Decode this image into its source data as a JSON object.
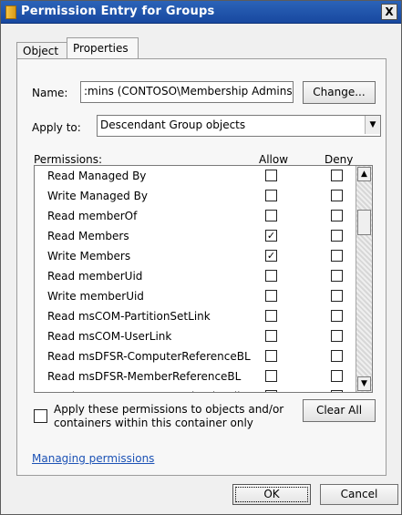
{
  "window": {
    "title": "Permission Entry for Groups",
    "close_label": "X"
  },
  "tabs": {
    "object": "Object",
    "properties": "Properties"
  },
  "name": {
    "label": "Name:",
    "value": ":mins (CONTOSO\\Membership Admins)",
    "change_button": "Change..."
  },
  "apply_to": {
    "label": "Apply to:",
    "value": "Descendant Group objects"
  },
  "permissions": {
    "header": "Permissions:",
    "allow_header": "Allow",
    "deny_header": "Deny",
    "rows": [
      {
        "name": "Read Managed By",
        "allow": false,
        "deny": false
      },
      {
        "name": "Write Managed By",
        "allow": false,
        "deny": false
      },
      {
        "name": "Read memberOf",
        "allow": false,
        "deny": false
      },
      {
        "name": "Read Members",
        "allow": true,
        "deny": false
      },
      {
        "name": "Write Members",
        "allow": true,
        "deny": false
      },
      {
        "name": "Read memberUid",
        "allow": false,
        "deny": false
      },
      {
        "name": "Write memberUid",
        "allow": false,
        "deny": false
      },
      {
        "name": "Read msCOM-PartitionSetLink",
        "allow": false,
        "deny": false
      },
      {
        "name": "Read msCOM-UserLink",
        "allow": false,
        "deny": false
      },
      {
        "name": "Read msDFSR-ComputerReferenceBL",
        "allow": false,
        "deny": false
      },
      {
        "name": "Read msDFSR-MemberReferenceBL",
        "allow": false,
        "deny": false
      },
      {
        "name": "Read msDS-Approx-Immed-Subordi",
        "allow": false,
        "deny": false
      }
    ]
  },
  "apply_checkbox": {
    "checked": false,
    "line1": "Apply these permissions to objects and/or",
    "line2": "containers within this container only"
  },
  "buttons": {
    "clear_all": "Clear All",
    "ok": "OK",
    "cancel": "Cancel"
  },
  "links": {
    "managing_permissions": "Managing permissions"
  }
}
